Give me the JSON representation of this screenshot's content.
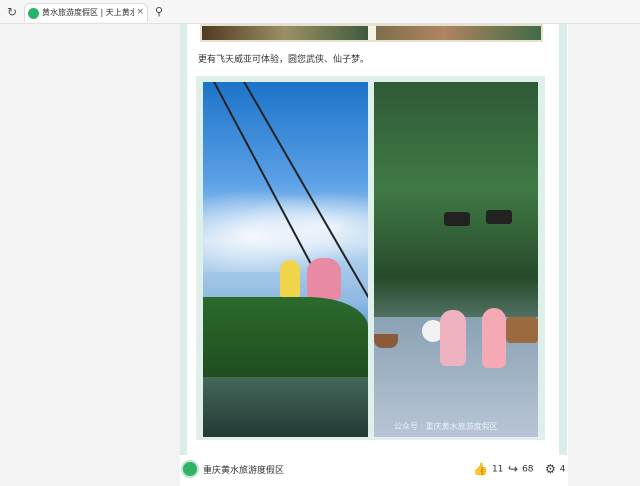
{
  "browser": {
    "tab_title": "黄水旅游度假区 | 天上黄水，",
    "tab_close": "×",
    "refresh_glyph": "↻",
    "search_glyph": "⚲",
    "icons": [
      "refresh-icon",
      "site-favicon",
      "close-icon",
      "search-icon"
    ]
  },
  "article": {
    "caption": "更有飞天威亚可体验，圆您武侠、仙子梦。",
    "watermark": "公众号 · 重庆黄水旅游度假区"
  },
  "footer": {
    "author": "重庆黄水旅游度假区",
    "likes": "11",
    "shares": "68",
    "settings_count": "4",
    "icons": [
      "thumbs-up-icon",
      "share-icon",
      "gear-icon"
    ]
  },
  "colors": {
    "accent_green": "#2fb466",
    "panel_mint": "#dff0ea"
  }
}
